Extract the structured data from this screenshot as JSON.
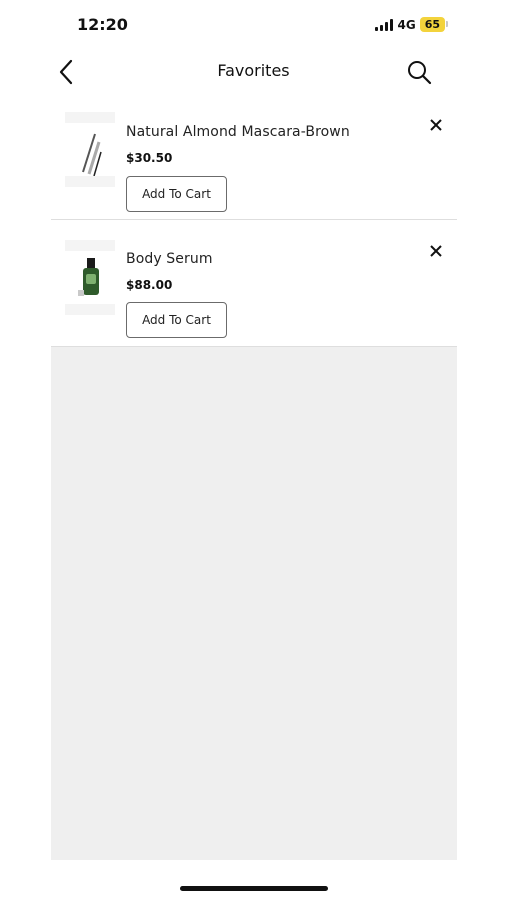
{
  "status_bar": {
    "time": "12:20",
    "network": "4G",
    "battery": "65",
    "battery_color": "#f3d33c"
  },
  "header": {
    "title": "Favorites",
    "back_icon": "chevron-left-icon",
    "search_icon": "search-icon"
  },
  "favorites": [
    {
      "name": "Natural Almond Mascara-Brown",
      "price": "$30.50",
      "button_label": "Add To Cart",
      "image": "mascara-wand-image",
      "remove_icon": "close-icon"
    },
    {
      "name": "Body Serum",
      "price": "$88.00",
      "button_label": "Add To Cart",
      "image": "serum-bottle-image",
      "remove_icon": "close-icon"
    }
  ]
}
